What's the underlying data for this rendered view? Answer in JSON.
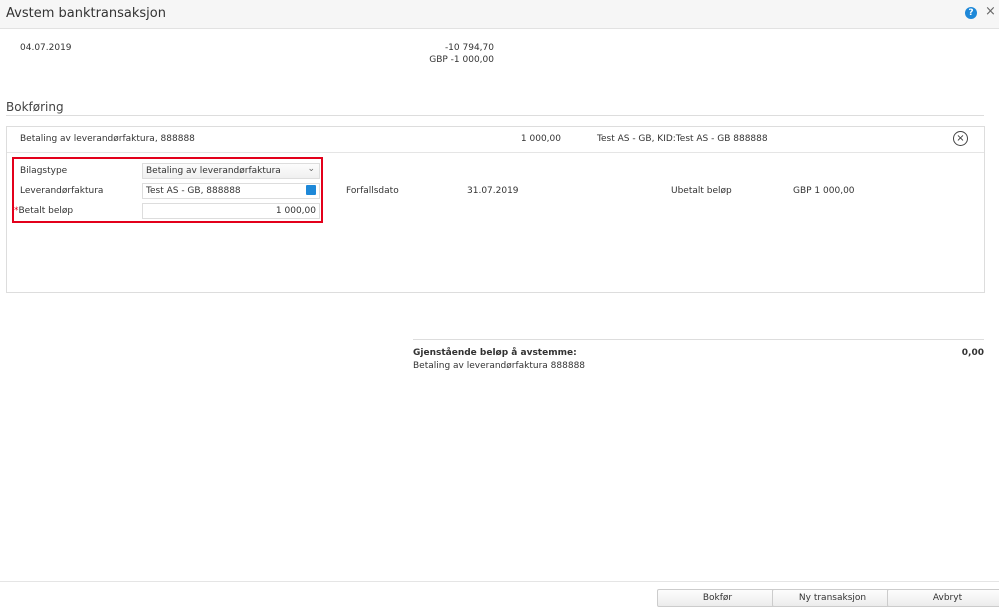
{
  "dialog": {
    "title": "Avstem banktransaksjon",
    "help_icon": "?",
    "close_icon": "×"
  },
  "transaction": {
    "date": "04.07.2019",
    "amount": "-10 794,70",
    "currency_amount": "GBP -1 000,00"
  },
  "section_title": "Bokføring",
  "entry": {
    "description": "Betaling av leverandørfaktura, 888888",
    "amount": "1 000,00",
    "reference": "Test AS - GB, KID:Test AS - GB 888888",
    "remove_icon": "×"
  },
  "form": {
    "voucher_type_label": "Bilagstype",
    "voucher_type_value": "Betaling av leverandørfaktura",
    "chevron": "⌄",
    "invoice_label": "Leverandørfaktura",
    "invoice_value": "Test AS - GB, 888888",
    "paid_label": "Betalt beløp",
    "required_mark": "*",
    "paid_value": "1 000,00",
    "due_label": "Forfallsdato",
    "due_value": "31.07.2019",
    "unpaid_label": "Ubetalt beløp",
    "unpaid_value": "GBP 1 000,00"
  },
  "summary": {
    "label": "Gjenstående beløp å avstemme:",
    "value": "0,00",
    "detail": "Betaling av leverandørfaktura 888888"
  },
  "buttons": {
    "post": "Bokfør",
    "new": "Ny transaksjon",
    "cancel": "Avbryt"
  }
}
